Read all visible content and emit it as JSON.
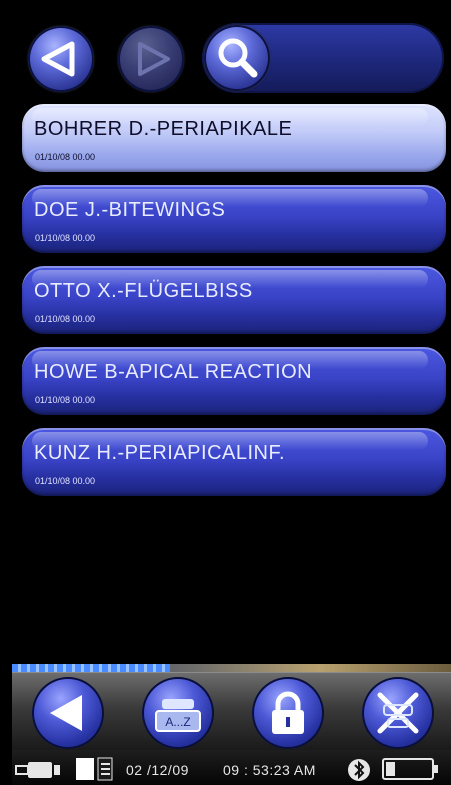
{
  "nav": {
    "back_icon": "triangle-left-icon",
    "forward_icon": "triangle-right-icon",
    "search_icon": "magnifier-icon",
    "search_value": ""
  },
  "records": [
    {
      "name": "BOHRER D.-PERIAPIKALE",
      "date": "01/10/08 00.00",
      "selected": true
    },
    {
      "name": "DOE J.-BITEWINGS",
      "date": "01/10/08 00.00",
      "selected": false
    },
    {
      "name": "OTTO X.-FLÜGELBIß",
      "date": "01/10/08 00.00",
      "selected": false
    },
    {
      "name": "HOWE B-APICAL REACTION",
      "date": "01/10/08 00.00",
      "selected": false
    },
    {
      "name": "KUNZ H.-PERIAPICALINF.",
      "date": "01/10/08 00.00",
      "selected": false
    }
  ],
  "progress_fraction": 0.36,
  "toolbar": {
    "back_icon": "arrow-left-icon",
    "sort_label": "A...Z",
    "lock_icon": "lock-icon",
    "cancel_icon": "cancel-x-icon"
  },
  "status": {
    "date": "02 /12/09",
    "time": "09 : 53:23 AM",
    "battery_fraction": 0.2
  },
  "colors": {
    "accent": "#3a44c8",
    "selected": "#c3ccf8",
    "background": "#000000"
  }
}
